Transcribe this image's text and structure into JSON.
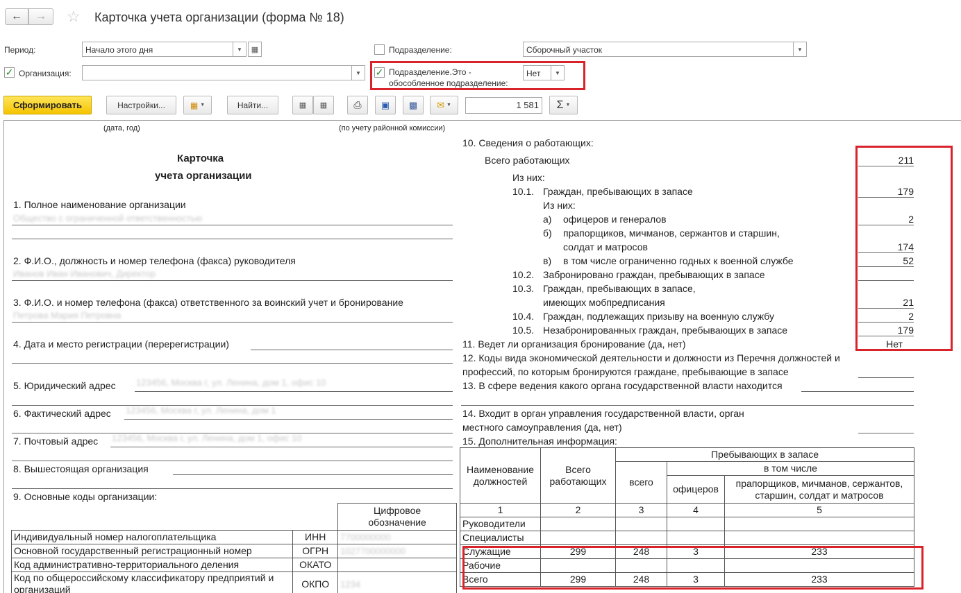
{
  "toolbar_top": {
    "title": "Карточка учета организации (форма № 18)"
  },
  "filters": {
    "period_label": "Период:",
    "period_value": "Начало этого дня",
    "org_label": "Организация:",
    "org_value": "",
    "subdiv_label": "Подразделение:",
    "subdiv_value": "Сборочный участок",
    "subdiv_separate_label_1": "Подразделение.Это -",
    "subdiv_separate_label_2": "обособленное подразделение:",
    "subdiv_separate_value": "Нет"
  },
  "actions": {
    "generate": "Сформировать",
    "settings": "Настройки...",
    "find": "Найти...",
    "sum_value": "1 581"
  },
  "report": {
    "caption_date": "(дата, год)",
    "caption_commission": "(по учету районной комиссии)",
    "title_1": "Карточка",
    "title_2": "учета организации",
    "item1": "1. Полное наименование организации",
    "item1_blur": "Общество с ограниченной ответственностью",
    "item2": "2. Ф.И.О., должность и номер телефона (факса) руководителя",
    "item2_blur": "Иванов Иван Иванович, Директор",
    "item3": "3. Ф.И.О. и номер телефона (факса) ответственного за воинский учет и бронирование",
    "item3_blur": "Петрова Мария Петровна",
    "item4": "4. Дата и место регистрации (перерегистрации)",
    "item5": "5. Юридический адрес",
    "item5_blur": "123456, Москва г, ул. Ленина, дом 1, офис 10",
    "item6": "6. Фактический адрес",
    "item6_blur": "123456, Москва г, ул. Ленина, дом 1",
    "item7": "7. Почтовый адрес",
    "item7_blur": "123456, Москва г, ул. Ленина, дом 1, офис 10",
    "item8": "8. Вышестоящая организация",
    "item9": "9. Основные коды организации:",
    "codes_header_1": "Цифровое",
    "codes_header_2": "обозначение",
    "codes": [
      {
        "name": "Индивидуальный номер налогоплательщика",
        "abbr": "ИНН",
        "value": "7700000000"
      },
      {
        "name": "Основной государственный регистрационный номер",
        "abbr": "ОГРН",
        "value": "1027700000000"
      },
      {
        "name": "Код административно-территориального деления",
        "abbr": "ОКАТО",
        "value": ""
      },
      {
        "name": "Код по общероссийскому классификатору предприятий и",
        "name2": "организаций",
        "abbr": "ОКПО",
        "value": "1234"
      }
    ],
    "item10": "10. Сведения о работающих:",
    "total_workers_label": "Всего работающих",
    "total_workers": "211",
    "of_them": "Из них:",
    "r10_1_num": "10.1.",
    "r10_1_label": "Граждан, пребывающих в запасе",
    "r10_1_val": "179",
    "of_them2": "Из них:",
    "ra_num": "а)",
    "ra_label": "офицеров и генералов",
    "ra_val": "2",
    "rb_num": "б)",
    "rb_label_1": "прапорщиков, мичманов, сержантов и старшин,",
    "rb_label_2": "солдат и матросов",
    "rb_val": "174",
    "rv_num": "в)",
    "rv_label": "в том числе ограниченно годных к военной службе",
    "rv_val": "52",
    "r10_2_num": "10.2.",
    "r10_2_label": "Забронировано граждан, пребывающих в запасе",
    "r10_2_val": "",
    "r10_3_num": "10.3.",
    "r10_3_label_1": "Граждан, пребывающих в запасе,",
    "r10_3_label_2": "имеющих мобпредписания",
    "r10_3_val": "21",
    "r10_4_num": "10.4.",
    "r10_4_label": "Граждан, подлежащих призыву на военную службу",
    "r10_4_val": "2",
    "r10_5_num": "10.5.",
    "r10_5_label": "Незабронированных граждан, пребывающих в запасе",
    "r10_5_val": "179",
    "item11": "11. Ведет ли организация бронирование (да, нет)",
    "item11_val": "Нет",
    "item12_1": "12. Коды вида экономической деятельности и должности из Перечня должностей и",
    "item12_2": "профессий, по которым бронируются граждане, пребывающие в запасе",
    "item13": "13. В сфере ведения какого органа государственной власти находится",
    "item14_1": "14.  Входит  в  орган управления государственной власти, орган",
    "item14_2": "местного самоуправления (да, нет)",
    "item15": "15. Дополнительная информация:",
    "table": {
      "h_name_1": "Наименование",
      "h_name_2": "должностей",
      "h_total_1": "Всего",
      "h_total_2": "работающих",
      "h_reserve": "Пребывающих в запасе",
      "h_incl": "в том числе",
      "h_all": "всего",
      "h_officers": "офицеров",
      "h_warrant_1": "прапорщиков, мичманов, сержантов,",
      "h_warrant_2": "старшин, солдат и матросов",
      "nums": [
        "1",
        "2",
        "3",
        "4",
        "5"
      ],
      "rows": [
        {
          "name": "Руководители",
          "total": "",
          "all": "",
          "off": "",
          "war": ""
        },
        {
          "name": "Специалисты",
          "total": "",
          "all": "",
          "off": "",
          "war": ""
        },
        {
          "name": "Служащие",
          "total": "299",
          "all": "248",
          "off": "3",
          "war": "233"
        },
        {
          "name": "Рабочие",
          "total": "",
          "all": "",
          "off": "",
          "war": ""
        },
        {
          "name": "Всего",
          "total": "299",
          "all": "248",
          "off": "3",
          "war": "233"
        }
      ]
    }
  }
}
